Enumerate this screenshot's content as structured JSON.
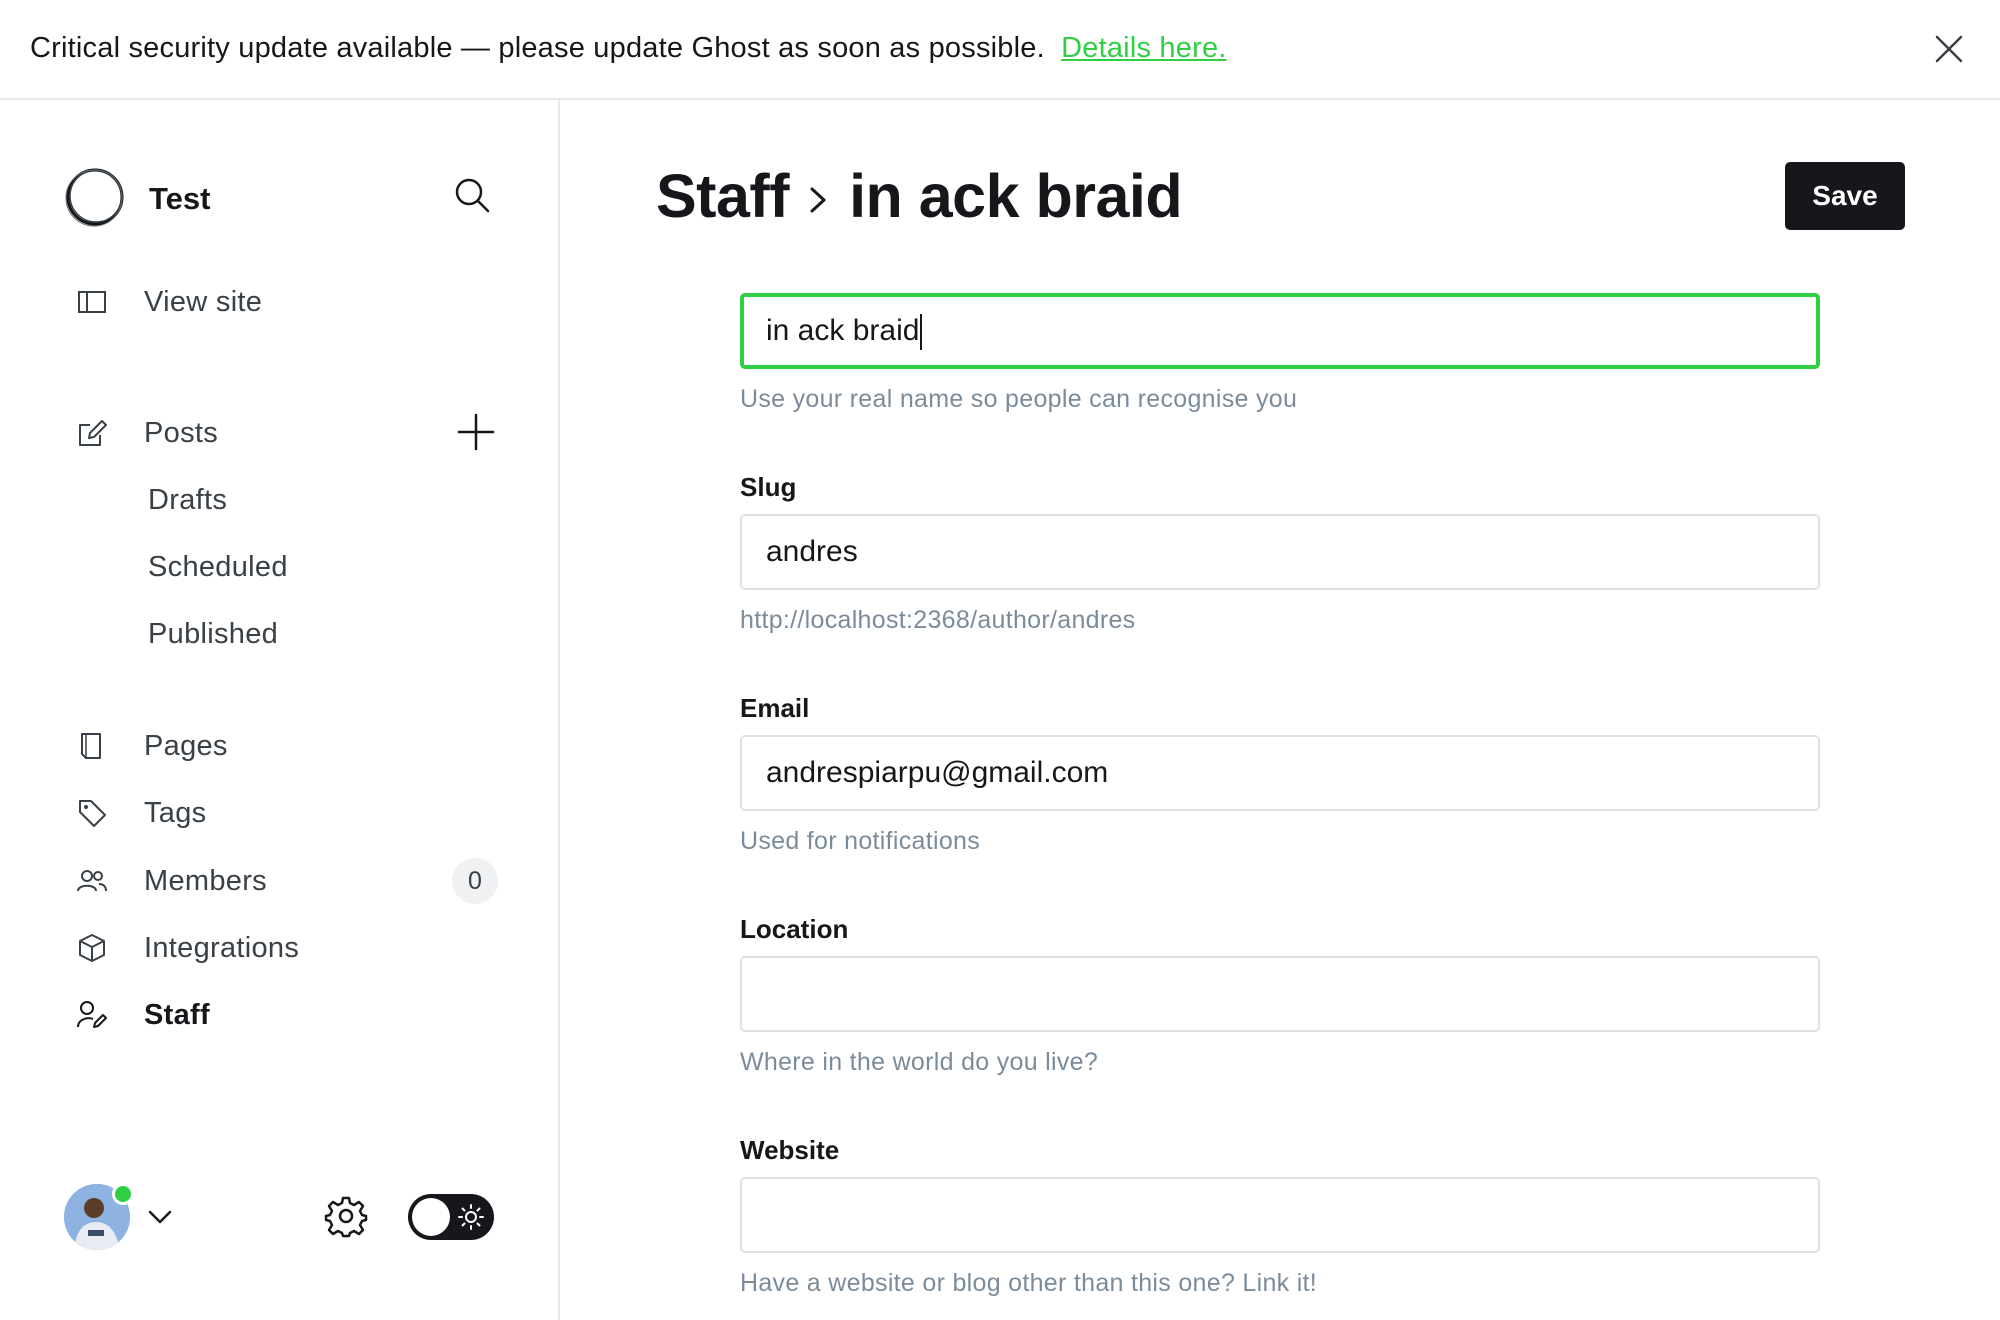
{
  "banner": {
    "message": "Critical security update available — please update Ghost as soon as possible.",
    "link_text": "Details here."
  },
  "sidebar": {
    "site_name": "Test",
    "view_site": "View site",
    "posts": "Posts",
    "drafts": "Drafts",
    "scheduled": "Scheduled",
    "published": "Published",
    "pages": "Pages",
    "tags": "Tags",
    "members": "Members",
    "members_count": "0",
    "integrations": "Integrations",
    "staff": "Staff"
  },
  "header": {
    "breadcrumb_parent": "Staff",
    "breadcrumb_current": "in ack braid",
    "save_label": "Save"
  },
  "form": {
    "name_value": "in ack braid",
    "name_help": "Use your real name so people can recognise you",
    "slug_label": "Slug",
    "slug_value": "andres",
    "slug_help": "http://localhost:2368/author/andres",
    "email_label": "Email",
    "email_value": "andrespiarpu@gmail.com",
    "email_help": "Used for notifications",
    "location_label": "Location",
    "location_value": "",
    "location_help": "Where in the world do you live?",
    "website_label": "Website",
    "website_value": "",
    "website_help": "Have a website or blog other than this one? Link it!"
  },
  "colors": {
    "accent": "#30cf43",
    "dark": "#15171a",
    "muted": "#7c8b9a"
  }
}
